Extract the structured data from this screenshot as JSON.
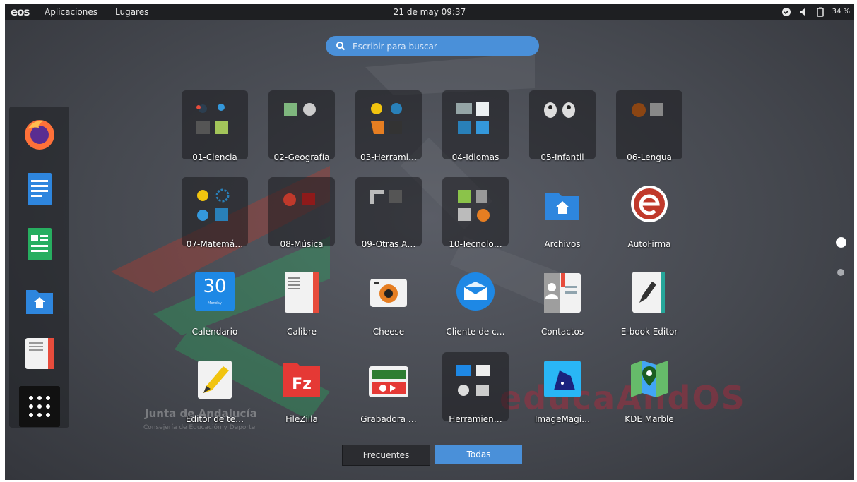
{
  "topbar": {
    "logo": "eos",
    "menu_apps": "Aplicaciones",
    "menu_places": "Lugares",
    "clock": "21 de may  09:37",
    "battery": "34 %"
  },
  "search": {
    "placeholder": "Escribir para buscar"
  },
  "dock": {
    "items": [
      "firefox-icon",
      "writer-icon",
      "calc-icon",
      "files-icon",
      "ebook-reader-icon",
      "show-apps-icon"
    ]
  },
  "grid": {
    "row1": [
      "01-Ciencia",
      "02-Geografía",
      "03-Herrami…",
      "04-Idiomas",
      "05-Infantil",
      "06-Lengua"
    ],
    "row2": [
      "07-Matemá…",
      "08-Música",
      "09-Otras A…",
      "10-Tecnolo…",
      "Archivos",
      "AutoFirma"
    ],
    "row3": [
      "Calendario",
      "Calibre",
      "Cheese",
      "Cliente de c…",
      "Contactos",
      "E-book Editor"
    ],
    "row4": [
      "Editor de te…",
      "FileZilla",
      "Grabadora …",
      "Herramien…",
      "ImageMagi…",
      "KDE Marble"
    ]
  },
  "calendar_day": "30",
  "calendar_weekday": "Monday",
  "tabs": {
    "frequent": "Frecuentes",
    "all": "Todas"
  },
  "watermark": {
    "line1": "Junta de Andalucía",
    "line2": "Consejería de Educación y Deporte",
    "line3": "educaAndOS"
  },
  "colors": {
    "accent": "#4a90d9",
    "topbar": "#1e1f22"
  }
}
